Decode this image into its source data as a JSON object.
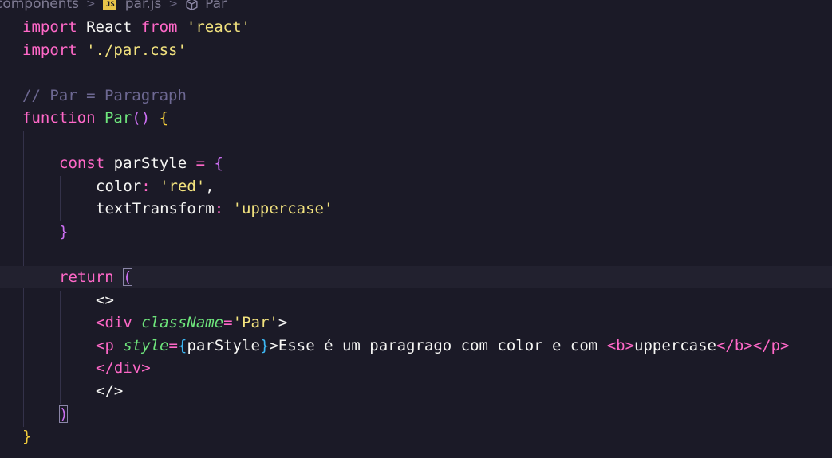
{
  "breadcrumb": {
    "folder": "components",
    "file_badge": "JS",
    "file": "par.js",
    "symbol": "Par"
  },
  "code": {
    "l1": {
      "kw1": "import",
      "id": " React ",
      "kw2": "from",
      "str": " 'react'"
    },
    "l2": {
      "kw": "import",
      "str": " './par.css'"
    },
    "l4": {
      "comment": "// Par = Paragraph"
    },
    "l5": {
      "kw": "function",
      "fn": " Par",
      "paren": "()",
      "brace": " {"
    },
    "l7": {
      "kw": "const",
      "id": " parStyle ",
      "op": "=",
      "brace": " {"
    },
    "l8": {
      "prop": "color",
      "colon": ": ",
      "str": "'red'",
      "comma": ","
    },
    "l9": {
      "prop": "textTransform",
      "colon": ": ",
      "str": "'uppercase'"
    },
    "l10": {
      "brace": "}"
    },
    "l12": {
      "kw": "return",
      "paren": "("
    },
    "l13": {
      "tag": "<>"
    },
    "l14": {
      "open": "<div",
      "attr": "className",
      "eq": "=",
      "str": "'Par'",
      "close": ">"
    },
    "l15": {
      "open": "<p",
      "attr": "style",
      "eq": "=",
      "lbrace": "{",
      "id": "parStyle",
      "rbrace": "}",
      "gt": ">",
      "text": "Esse é um paragrago com color e com ",
      "b_open": "<b>",
      "b_text": "uppercase",
      "b_close": "</b>",
      "p_close": "</p>"
    },
    "l16": {
      "tag": "</div>"
    },
    "l17": {
      "tag": "</>"
    },
    "l18": {
      "paren": ")"
    },
    "l19": {
      "brace": "}"
    }
  },
  "colors": {
    "background": "#1b1a27",
    "keyword": "#ff68c8",
    "string": "#f2e27e",
    "comment": "#6d6892",
    "function": "#6ee57c",
    "bracket_level1": "#f4ce3c",
    "bracket_level2": "#cc6ff2",
    "bracket_level3": "#3db8f5"
  }
}
